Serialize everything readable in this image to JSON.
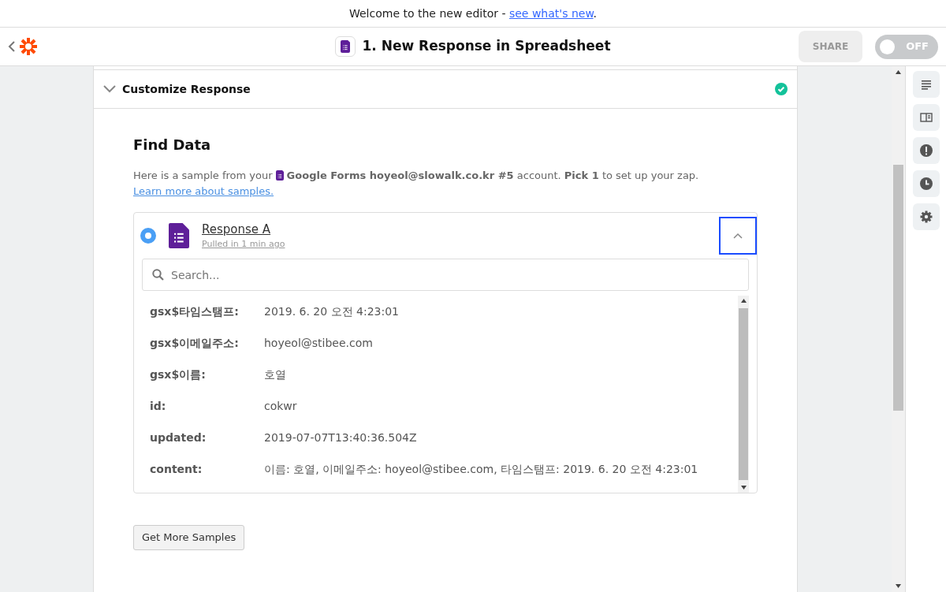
{
  "banner": {
    "text": "Welcome to the new editor -",
    "link": "see what's new",
    "end": "."
  },
  "header": {
    "title": "1. New Response in Spreadsheet",
    "share": "SHARE",
    "toggle": {
      "label": "OFF",
      "on": false
    }
  },
  "section": {
    "title": "Customize Response",
    "expanded": true,
    "complete": true
  },
  "find": {
    "title": "Find Data",
    "intro_start": "Here is a sample from your",
    "intro_rest": "**Google Forms hoyeol@slowalk.co.kr #5** account. **Pick 1** to set up your zap.",
    "intro_link": "Learn more about samples."
  },
  "sample": {
    "title": "Response A",
    "subtitle": "Pulled in 1 min ago",
    "selected": true,
    "expanded": true,
    "search": {
      "placeholder": "Search..."
    },
    "fields": [
      {
        "key": "gsx$타임스탬프:",
        "value": "2019. 6. 20 오전 4:23:01"
      },
      {
        "key": "gsx$이메일주소:",
        "value": "hoyeol@stibee.com"
      },
      {
        "key": "gsx$이름:",
        "value": "호열"
      },
      {
        "key": "id:",
        "value": "cokwr"
      },
      {
        "key": "updated:",
        "value": "2019-07-07T13:40:36.504Z"
      },
      {
        "key": "content:",
        "value": "이름: 호열, 이메일주소: hoyeol@stibee.com, 타임스탬프: 2019. 6. 20 오전 4:23:01"
      }
    ]
  },
  "more_button": "Get More Samples"
}
